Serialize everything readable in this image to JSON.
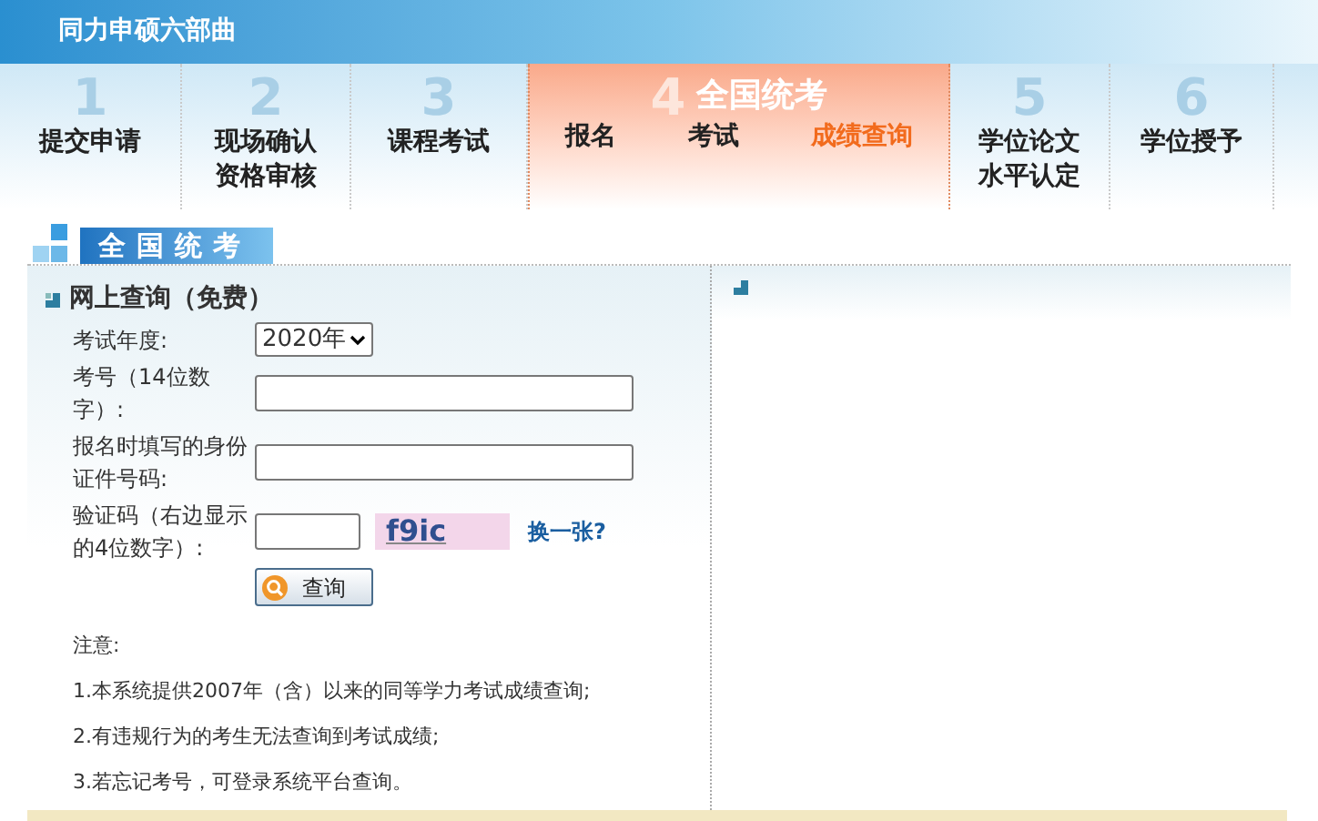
{
  "header": {
    "title": "同力申硕六部曲"
  },
  "steps": [
    {
      "number": "1",
      "lines": [
        "提交申请"
      ],
      "selected": false
    },
    {
      "number": "2",
      "lines": [
        "现场确认",
        "资格审核"
      ],
      "selected": false
    },
    {
      "number": "3",
      "lines": [
        "课程考试"
      ],
      "selected": false
    },
    {
      "number": "4",
      "label": "全国统考",
      "selected": true,
      "substeps": [
        {
          "label": "报名",
          "selected": false
        },
        {
          "label": "考试",
          "selected": false
        },
        {
          "label": "成绩查询",
          "selected": true
        }
      ]
    },
    {
      "number": "5",
      "lines": [
        "学位论文",
        "水平认定"
      ],
      "selected": false
    },
    {
      "number": "6",
      "lines": [
        "学位授予"
      ],
      "selected": false
    }
  ],
  "section_title": "全国统考",
  "form": {
    "title": "网上查询（免费）",
    "year": {
      "label": "考试年度:",
      "value": "2020年"
    },
    "exam_number": {
      "label": "考号（14位数字）:"
    },
    "id_number": {
      "label": "报名时填写的身份证件号码:"
    },
    "captcha": {
      "label": "验证码（右边显示的4位数字）:",
      "image_text": "f9ic",
      "refresh_link": "换一张?"
    },
    "submit": "查询"
  },
  "notes": [
    "注意:",
    "1.本系统提供2007年（含）以来的同等学力考试成绩查询;",
    "2.有违规行为的考生无法查询到考试成绩;",
    "3.若忘记考号，可登录系统平台查询。"
  ]
}
